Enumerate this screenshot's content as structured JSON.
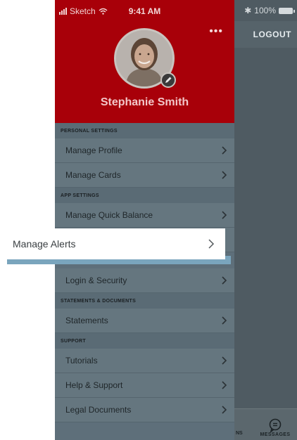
{
  "status": {
    "carrier": "Sketch",
    "time": "9:41 AM",
    "battery": "100%"
  },
  "header": {
    "right_action": "LOGOUT",
    "profile_name": "Stephanie Smith",
    "more_icon": "more-dots-icon",
    "edit_icon": "pencil-icon"
  },
  "sections": {
    "personal": "PERSONAL SETTINGS",
    "app": "APP SETTINGS",
    "statements": "STATEMENTS & DOCUMENTS",
    "support": "SUPPORT"
  },
  "menu": {
    "manage_profile": "Manage Profile",
    "manage_cards": "Manage Cards",
    "manage_quick_balance": "Manage Quick Balance",
    "login_security": "Login & Security",
    "statements": "Statements",
    "tutorials": "Tutorials",
    "help_support": "Help & Support",
    "legal_documents": "Legal Documents"
  },
  "highlight": {
    "label": "Manage Alerts"
  },
  "tabbar": {
    "partial_label": "NS",
    "messages_label": "MESSAGES"
  },
  "colors": {
    "brand_red": "#a80009",
    "drawer_bg": "#5e6f7a",
    "highlight_shadow": "#7aa5bd"
  }
}
